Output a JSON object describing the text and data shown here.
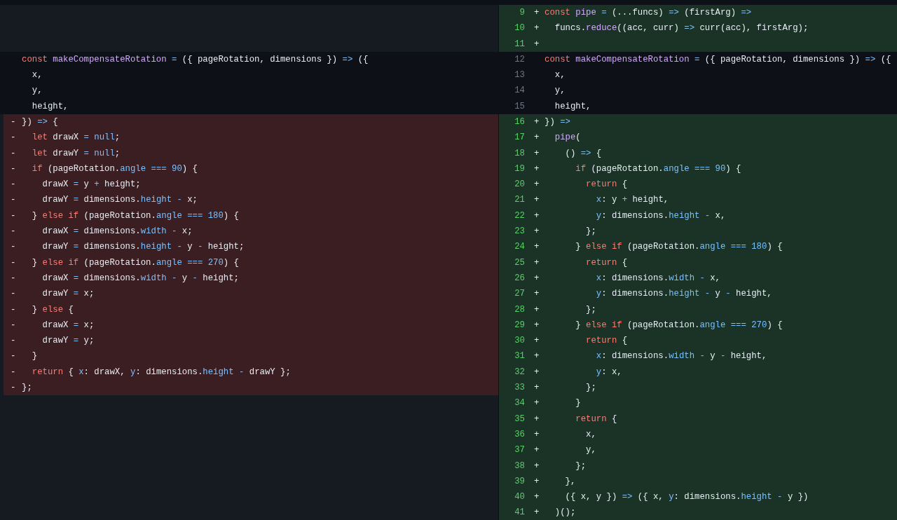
{
  "left_pane": {
    "rows": [
      {
        "kind": "empty"
      },
      {
        "kind": "empty"
      },
      {
        "kind": "empty"
      },
      {
        "kind": "context",
        "code": [
          {
            "text": "const",
            "kind": "keyword"
          },
          {
            "text": " makeCompensateRotation",
            "kind": "function"
          },
          {
            "text": " =",
            "kind": "constant"
          },
          {
            "text": " ({ pageRotation, dimensions }) ",
            "kind": "plain"
          },
          {
            "text": "=>",
            "kind": "constant"
          },
          {
            "text": " ({",
            "kind": "plain"
          }
        ]
      },
      {
        "kind": "context",
        "code": [
          {
            "text": "  x,",
            "kind": "plain"
          }
        ]
      },
      {
        "kind": "context",
        "code": [
          {
            "text": "  y,",
            "kind": "plain"
          }
        ]
      },
      {
        "kind": "context",
        "code": [
          {
            "text": "  height,",
            "kind": "plain"
          }
        ]
      },
      {
        "kind": "deleted",
        "marker": "-",
        "code": [
          {
            "text": "}) ",
            "kind": "plain"
          },
          {
            "text": "=>",
            "kind": "constant"
          },
          {
            "text": " {",
            "kind": "plain"
          }
        ]
      },
      {
        "kind": "deleted",
        "marker": "-",
        "code": [
          {
            "text": "  let",
            "kind": "keyword"
          },
          {
            "text": " drawX ",
            "kind": "plain"
          },
          {
            "text": "=",
            "kind": "constant"
          },
          {
            "text": " null",
            "kind": "constant"
          },
          {
            "text": ";",
            "kind": "plain"
          }
        ]
      },
      {
        "kind": "deleted",
        "marker": "-",
        "code": [
          {
            "text": "  let",
            "kind": "keyword"
          },
          {
            "text": " drawY ",
            "kind": "plain"
          },
          {
            "text": "=",
            "kind": "constant"
          },
          {
            "text": " null",
            "kind": "constant"
          },
          {
            "text": ";",
            "kind": "plain"
          }
        ]
      },
      {
        "kind": "deleted",
        "marker": "-",
        "code": [
          {
            "text": "  if",
            "kind": "keyword"
          },
          {
            "text": " (pageRotation.",
            "kind": "plain"
          },
          {
            "text": "angle",
            "kind": "constant"
          },
          {
            "text": " ===",
            "kind": "constant"
          },
          {
            "text": " 90",
            "kind": "constant"
          },
          {
            "text": ") {",
            "kind": "plain"
          }
        ]
      },
      {
        "kind": "deleted",
        "marker": "-",
        "code": [
          {
            "text": "    drawX ",
            "kind": "plain"
          },
          {
            "text": "=",
            "kind": "constant"
          },
          {
            "text": " y ",
            "kind": "plain"
          },
          {
            "text": "+",
            "kind": "constant"
          },
          {
            "text": " height;",
            "kind": "plain"
          }
        ]
      },
      {
        "kind": "deleted",
        "marker": "-",
        "code": [
          {
            "text": "    drawY ",
            "kind": "plain"
          },
          {
            "text": "=",
            "kind": "constant"
          },
          {
            "text": " dimensions.",
            "kind": "plain"
          },
          {
            "text": "height",
            "kind": "constant"
          },
          {
            "text": " -",
            "kind": "constant"
          },
          {
            "text": " x;",
            "kind": "plain"
          }
        ]
      },
      {
        "kind": "deleted",
        "marker": "-",
        "code": [
          {
            "text": "  } ",
            "kind": "plain"
          },
          {
            "text": "else if",
            "kind": "keyword"
          },
          {
            "text": " (pageRotation.",
            "kind": "plain"
          },
          {
            "text": "angle",
            "kind": "constant"
          },
          {
            "text": " ===",
            "kind": "constant"
          },
          {
            "text": " 180",
            "kind": "constant"
          },
          {
            "text": ") {",
            "kind": "plain"
          }
        ]
      },
      {
        "kind": "deleted",
        "marker": "-",
        "code": [
          {
            "text": "    drawX ",
            "kind": "plain"
          },
          {
            "text": "=",
            "kind": "constant"
          },
          {
            "text": " dimensions.",
            "kind": "plain"
          },
          {
            "text": "width",
            "kind": "constant"
          },
          {
            "text": " -",
            "kind": "constant"
          },
          {
            "text": " x;",
            "kind": "plain"
          }
        ]
      },
      {
        "kind": "deleted",
        "marker": "-",
        "code": [
          {
            "text": "    drawY ",
            "kind": "plain"
          },
          {
            "text": "=",
            "kind": "constant"
          },
          {
            "text": " dimensions.",
            "kind": "plain"
          },
          {
            "text": "height",
            "kind": "constant"
          },
          {
            "text": " -",
            "kind": "constant"
          },
          {
            "text": " y ",
            "kind": "plain"
          },
          {
            "text": "-",
            "kind": "constant"
          },
          {
            "text": " height;",
            "kind": "plain"
          }
        ]
      },
      {
        "kind": "deleted",
        "marker": "-",
        "code": [
          {
            "text": "  } ",
            "kind": "plain"
          },
          {
            "text": "else if",
            "kind": "keyword"
          },
          {
            "text": " (pageRotation.",
            "kind": "plain"
          },
          {
            "text": "angle",
            "kind": "constant"
          },
          {
            "text": " ===",
            "kind": "constant"
          },
          {
            "text": " 270",
            "kind": "constant"
          },
          {
            "text": ") {",
            "kind": "plain"
          }
        ]
      },
      {
        "kind": "deleted",
        "marker": "-",
        "code": [
          {
            "text": "    drawX ",
            "kind": "plain"
          },
          {
            "text": "=",
            "kind": "constant"
          },
          {
            "text": " dimensions.",
            "kind": "plain"
          },
          {
            "text": "width",
            "kind": "constant"
          },
          {
            "text": " -",
            "kind": "constant"
          },
          {
            "text": " y ",
            "kind": "plain"
          },
          {
            "text": "-",
            "kind": "constant"
          },
          {
            "text": " height;",
            "kind": "plain"
          }
        ]
      },
      {
        "kind": "deleted",
        "marker": "-",
        "code": [
          {
            "text": "    drawY ",
            "kind": "plain"
          },
          {
            "text": "=",
            "kind": "constant"
          },
          {
            "text": " x;",
            "kind": "plain"
          }
        ]
      },
      {
        "kind": "deleted",
        "marker": "-",
        "code": [
          {
            "text": "  } ",
            "kind": "plain"
          },
          {
            "text": "else",
            "kind": "keyword"
          },
          {
            "text": " {",
            "kind": "plain"
          }
        ]
      },
      {
        "kind": "deleted",
        "marker": "-",
        "code": [
          {
            "text": "    drawX ",
            "kind": "plain"
          },
          {
            "text": "=",
            "kind": "constant"
          },
          {
            "text": " x;",
            "kind": "plain"
          }
        ]
      },
      {
        "kind": "deleted",
        "marker": "-",
        "code": [
          {
            "text": "    drawY ",
            "kind": "plain"
          },
          {
            "text": "=",
            "kind": "constant"
          },
          {
            "text": " y;",
            "kind": "plain"
          }
        ]
      },
      {
        "kind": "deleted",
        "marker": "-",
        "code": [
          {
            "text": "  }",
            "kind": "plain"
          }
        ]
      },
      {
        "kind": "deleted",
        "marker": "-",
        "code": [
          {
            "text": "  return",
            "kind": "keyword"
          },
          {
            "text": " { ",
            "kind": "plain"
          },
          {
            "text": "x",
            "kind": "constant"
          },
          {
            "text": ": drawX, ",
            "kind": "plain"
          },
          {
            "text": "y",
            "kind": "constant"
          },
          {
            "text": ": dimensions.",
            "kind": "plain"
          },
          {
            "text": "height",
            "kind": "constant"
          },
          {
            "text": " -",
            "kind": "constant"
          },
          {
            "text": " drawY };",
            "kind": "plain"
          }
        ]
      },
      {
        "kind": "deleted",
        "marker": "-",
        "code": [
          {
            "text": "};",
            "kind": "plain"
          }
        ]
      }
    ]
  },
  "right_pane": {
    "rows": [
      {
        "kind": "added",
        "line_number": "9",
        "marker": "+",
        "code": [
          {
            "text": "const",
            "kind": "keyword"
          },
          {
            "text": " pipe",
            "kind": "function"
          },
          {
            "text": " =",
            "kind": "constant"
          },
          {
            "text": " (...funcs) ",
            "kind": "plain"
          },
          {
            "text": "=>",
            "kind": "constant"
          },
          {
            "text": " (firstArg) ",
            "kind": "plain"
          },
          {
            "text": "=>",
            "kind": "constant"
          }
        ]
      },
      {
        "kind": "added",
        "line_number": "10",
        "marker": "+",
        "code": [
          {
            "text": "  funcs.",
            "kind": "plain"
          },
          {
            "text": "reduce",
            "kind": "function"
          },
          {
            "text": "((acc, curr) ",
            "kind": "plain"
          },
          {
            "text": "=>",
            "kind": "constant"
          },
          {
            "text": " curr(acc), firstArg);",
            "kind": "plain"
          }
        ]
      },
      {
        "kind": "added",
        "line_number": "11",
        "marker": "+"
      },
      {
        "kind": "context",
        "line_number": "12",
        "code": [
          {
            "text": "const",
            "kind": "keyword"
          },
          {
            "text": " makeCompensateRotation",
            "kind": "function"
          },
          {
            "text": " =",
            "kind": "constant"
          },
          {
            "text": " ({ pageRotation, dimensions }) ",
            "kind": "plain"
          },
          {
            "text": "=>",
            "kind": "constant"
          },
          {
            "text": " ({",
            "kind": "plain"
          }
        ]
      },
      {
        "kind": "context",
        "line_number": "13",
        "code": [
          {
            "text": "  x,",
            "kind": "plain"
          }
        ]
      },
      {
        "kind": "context",
        "line_number": "14",
        "code": [
          {
            "text": "  y,",
            "kind": "plain"
          }
        ]
      },
      {
        "kind": "context",
        "line_number": "15",
        "code": [
          {
            "text": "  height,",
            "kind": "plain"
          }
        ]
      },
      {
        "kind": "added",
        "line_number": "16",
        "marker": "+",
        "code": [
          {
            "text": "}) ",
            "kind": "plain"
          },
          {
            "text": "=>",
            "kind": "constant"
          }
        ]
      },
      {
        "kind": "added",
        "line_number": "17",
        "marker": "+",
        "code": [
          {
            "text": "  pipe",
            "kind": "function"
          },
          {
            "text": "(",
            "kind": "plain"
          }
        ]
      },
      {
        "kind": "added",
        "line_number": "18",
        "marker": "+",
        "code": [
          {
            "text": "    () ",
            "kind": "plain"
          },
          {
            "text": "=>",
            "kind": "constant"
          },
          {
            "text": " {",
            "kind": "plain"
          }
        ]
      },
      {
        "kind": "added",
        "line_number": "19",
        "marker": "+",
        "code": [
          {
            "text": "      if",
            "kind": "keyword"
          },
          {
            "text": " (pageRotation.",
            "kind": "plain"
          },
          {
            "text": "angle",
            "kind": "constant"
          },
          {
            "text": " ===",
            "kind": "constant"
          },
          {
            "text": " 90",
            "kind": "constant"
          },
          {
            "text": ") {",
            "kind": "plain"
          }
        ]
      },
      {
        "kind": "added",
        "line_number": "20",
        "marker": "+",
        "code": [
          {
            "text": "        return",
            "kind": "keyword"
          },
          {
            "text": " {",
            "kind": "plain"
          }
        ]
      },
      {
        "kind": "added",
        "line_number": "21",
        "marker": "+",
        "code": [
          {
            "text": "          x",
            "kind": "constant"
          },
          {
            "text": ": y ",
            "kind": "plain"
          },
          {
            "text": "+",
            "kind": "constant"
          },
          {
            "text": " height,",
            "kind": "plain"
          }
        ]
      },
      {
        "kind": "added",
        "line_number": "22",
        "marker": "+",
        "code": [
          {
            "text": "          y",
            "kind": "constant"
          },
          {
            "text": ": dimensions.",
            "kind": "plain"
          },
          {
            "text": "height",
            "kind": "constant"
          },
          {
            "text": " -",
            "kind": "constant"
          },
          {
            "text": " x,",
            "kind": "plain"
          }
        ]
      },
      {
        "kind": "added",
        "line_number": "23",
        "marker": "+",
        "code": [
          {
            "text": "        };",
            "kind": "plain"
          }
        ]
      },
      {
        "kind": "added",
        "line_number": "24",
        "marker": "+",
        "code": [
          {
            "text": "      } ",
            "kind": "plain"
          },
          {
            "text": "else if",
            "kind": "keyword"
          },
          {
            "text": " (pageRotation.",
            "kind": "plain"
          },
          {
            "text": "angle",
            "kind": "constant"
          },
          {
            "text": " ===",
            "kind": "constant"
          },
          {
            "text": " 180",
            "kind": "constant"
          },
          {
            "text": ") {",
            "kind": "plain"
          }
        ]
      },
      {
        "kind": "added",
        "line_number": "25",
        "marker": "+",
        "code": [
          {
            "text": "        return",
            "kind": "keyword"
          },
          {
            "text": " {",
            "kind": "plain"
          }
        ]
      },
      {
        "kind": "added",
        "line_number": "26",
        "marker": "+",
        "code": [
          {
            "text": "          x",
            "kind": "constant"
          },
          {
            "text": ": dimensions.",
            "kind": "plain"
          },
          {
            "text": "width",
            "kind": "constant"
          },
          {
            "text": " -",
            "kind": "constant"
          },
          {
            "text": " x,",
            "kind": "plain"
          }
        ]
      },
      {
        "kind": "added",
        "line_number": "27",
        "marker": "+",
        "code": [
          {
            "text": "          y",
            "kind": "constant"
          },
          {
            "text": ": dimensions.",
            "kind": "plain"
          },
          {
            "text": "height",
            "kind": "constant"
          },
          {
            "text": " -",
            "kind": "constant"
          },
          {
            "text": " y ",
            "kind": "plain"
          },
          {
            "text": "-",
            "kind": "constant"
          },
          {
            "text": " height,",
            "kind": "plain"
          }
        ]
      },
      {
        "kind": "added",
        "line_number": "28",
        "marker": "+",
        "code": [
          {
            "text": "        };",
            "kind": "plain"
          }
        ]
      },
      {
        "kind": "added",
        "line_number": "29",
        "marker": "+",
        "code": [
          {
            "text": "      } ",
            "kind": "plain"
          },
          {
            "text": "else if",
            "kind": "keyword"
          },
          {
            "text": " (pageRotation.",
            "kind": "plain"
          },
          {
            "text": "angle",
            "kind": "constant"
          },
          {
            "text": " ===",
            "kind": "constant"
          },
          {
            "text": " 270",
            "kind": "constant"
          },
          {
            "text": ") {",
            "kind": "plain"
          }
        ]
      },
      {
        "kind": "added",
        "line_number": "30",
        "marker": "+",
        "code": [
          {
            "text": "        return",
            "kind": "keyword"
          },
          {
            "text": " {",
            "kind": "plain"
          }
        ]
      },
      {
        "kind": "added",
        "line_number": "31",
        "marker": "+",
        "code": [
          {
            "text": "          x",
            "kind": "constant"
          },
          {
            "text": ": dimensions.",
            "kind": "plain"
          },
          {
            "text": "width",
            "kind": "constant"
          },
          {
            "text": " -",
            "kind": "constant"
          },
          {
            "text": " y ",
            "kind": "plain"
          },
          {
            "text": "-",
            "kind": "constant"
          },
          {
            "text": " height,",
            "kind": "plain"
          }
        ]
      },
      {
        "kind": "added",
        "line_number": "32",
        "marker": "+",
        "code": [
          {
            "text": "          y",
            "kind": "constant"
          },
          {
            "text": ": x,",
            "kind": "plain"
          }
        ]
      },
      {
        "kind": "added",
        "line_number": "33",
        "marker": "+",
        "code": [
          {
            "text": "        };",
            "kind": "plain"
          }
        ]
      },
      {
        "kind": "added",
        "line_number": "34",
        "marker": "+",
        "code": [
          {
            "text": "      }",
            "kind": "plain"
          }
        ]
      },
      {
        "kind": "added",
        "line_number": "35",
        "marker": "+",
        "code": [
          {
            "text": "      return",
            "kind": "keyword"
          },
          {
            "text": " {",
            "kind": "plain"
          }
        ]
      },
      {
        "kind": "added",
        "line_number": "36",
        "marker": "+",
        "code": [
          {
            "text": "        x,",
            "kind": "plain"
          }
        ]
      },
      {
        "kind": "added",
        "line_number": "37",
        "marker": "+",
        "code": [
          {
            "text": "        y,",
            "kind": "plain"
          }
        ]
      },
      {
        "kind": "added",
        "line_number": "38",
        "marker": "+",
        "code": [
          {
            "text": "      };",
            "kind": "plain"
          }
        ]
      },
      {
        "kind": "added",
        "line_number": "39",
        "marker": "+",
        "code": [
          {
            "text": "    },",
            "kind": "plain"
          }
        ]
      },
      {
        "kind": "added",
        "line_number": "40",
        "marker": "+",
        "code": [
          {
            "text": "    ({ x, y }) ",
            "kind": "plain"
          },
          {
            "text": "=>",
            "kind": "constant"
          },
          {
            "text": " ({ x, ",
            "kind": "plain"
          },
          {
            "text": "y",
            "kind": "constant"
          },
          {
            "text": ": dimensions.",
            "kind": "plain"
          },
          {
            "text": "height",
            "kind": "constant"
          },
          {
            "text": " -",
            "kind": "constant"
          },
          {
            "text": " y })",
            "kind": "plain"
          }
        ]
      },
      {
        "kind": "added",
        "line_number": "41",
        "marker": "+",
        "code": [
          {
            "text": "  )();",
            "kind": "plain"
          }
        ]
      }
    ]
  }
}
